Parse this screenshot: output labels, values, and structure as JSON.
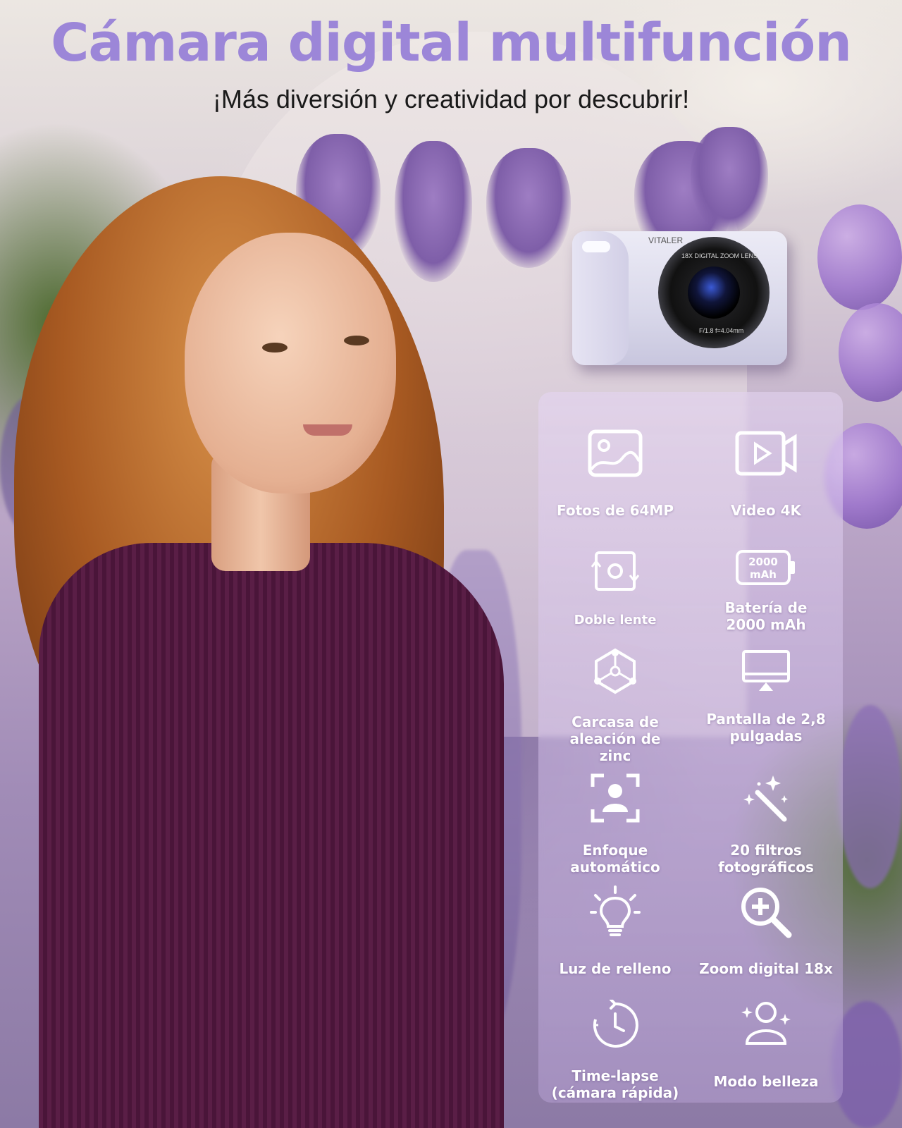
{
  "headline": "Cámara digital multifunción",
  "subheadline": "¡Más diversión y creatividad por descubrir!",
  "camera": {
    "brand": "VITALER",
    "lens_text": "18X DIGITAL ZOOM LENS",
    "lens_spec": "F/1.8  f=4.04mm"
  },
  "features": [
    {
      "label": "Fotos de 64MP",
      "icon": "photo-icon"
    },
    {
      "label": "Video 4K",
      "icon": "video-icon"
    },
    {
      "label": "Doble lente",
      "icon": "dual-lens-icon"
    },
    {
      "label": "Batería de 2000 mAh",
      "icon": "battery-icon",
      "icon_text": [
        "2000",
        "mAh"
      ]
    },
    {
      "label": "Carcasa de aleación de zinc",
      "icon": "zinc-alloy-icon"
    },
    {
      "label": "Pantalla de 2,8 pulgadas",
      "icon": "screen-icon"
    },
    {
      "label": "Enfoque automático",
      "icon": "autofocus-icon"
    },
    {
      "label": "20 filtros fotográficos",
      "icon": "magic-wand-icon"
    },
    {
      "label": "Luz de relleno",
      "icon": "light-bulb-icon"
    },
    {
      "label": "Zoom digital 18x",
      "icon": "zoom-icon"
    },
    {
      "label": "Time-lapse (cámara rápida)",
      "icon": "timer-icon"
    },
    {
      "label": "Modo belleza",
      "icon": "beauty-icon"
    }
  ],
  "colors": {
    "headline": "#9c86d8",
    "subheadline": "#1a1a1a",
    "feature_text": "#ffffff"
  }
}
